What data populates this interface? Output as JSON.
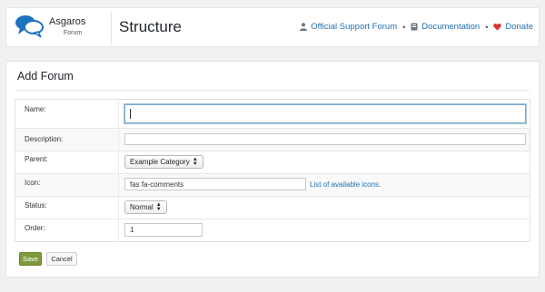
{
  "header": {
    "logo": {
      "name": "Asgaros",
      "sub": "Forum"
    },
    "title": "Structure",
    "links": {
      "support": "Official Support Forum",
      "documentation": "Documentation",
      "donate": "Donate"
    },
    "separator": "•"
  },
  "panel": {
    "title": "Add Forum",
    "fields": {
      "name": {
        "label": "Name:",
        "value": ""
      },
      "description": {
        "label": "Description:",
        "value": ""
      },
      "parent": {
        "label": "Parent:",
        "value": "Example Category"
      },
      "icon": {
        "label": "Icon:",
        "value": "fas fa-comments",
        "link": "List of available icons."
      },
      "status": {
        "label": "Status:",
        "value": "Normal"
      },
      "order": {
        "label": "Order:",
        "value": "1"
      }
    },
    "buttons": {
      "save": "Save",
      "cancel": "Cancel"
    }
  },
  "colors": {
    "link": "#2271b1",
    "save": "#7f9a3e",
    "donate_heart": "#d63638",
    "logo_blue": "#1e73be"
  }
}
